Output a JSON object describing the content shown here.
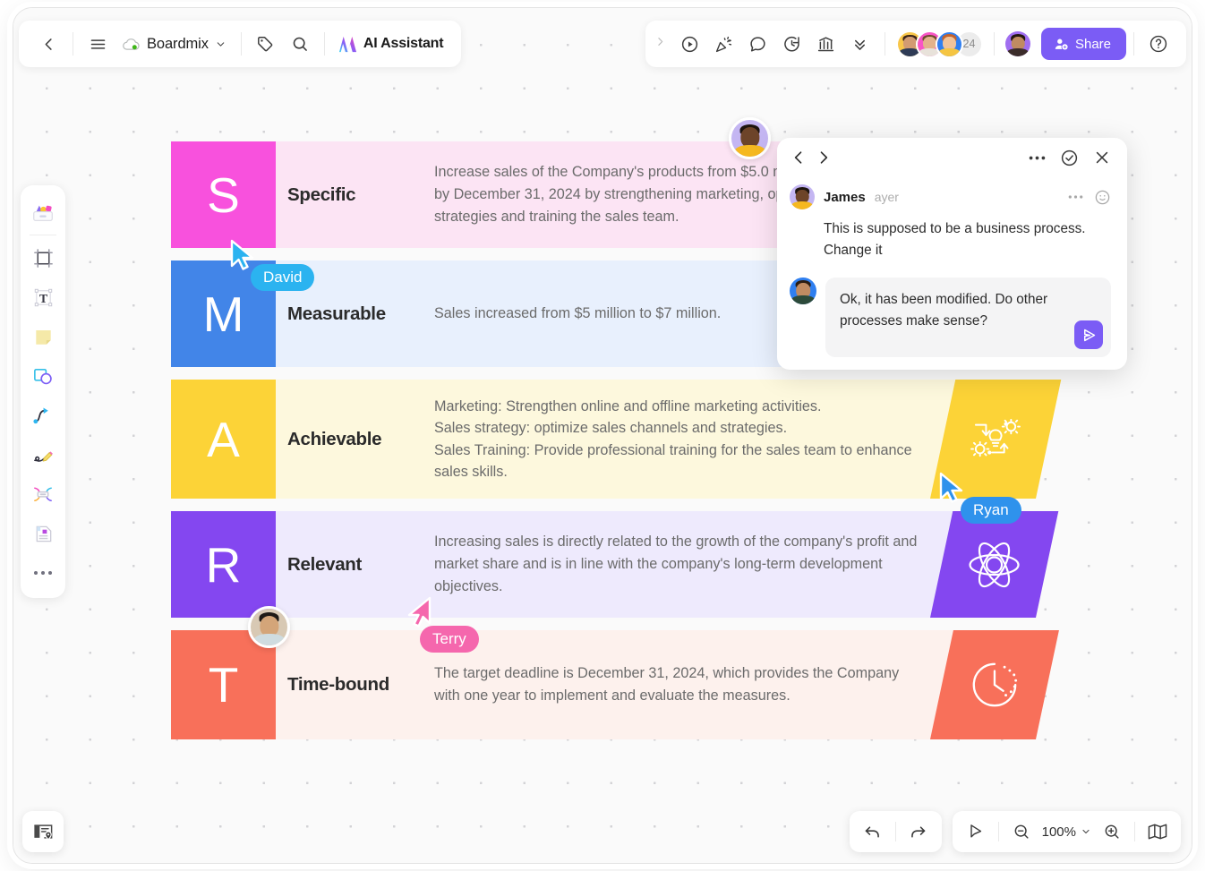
{
  "app": {
    "doc_title": "Boardmix",
    "ai_assistant_label": "AI Assistant"
  },
  "toolbar": {
    "back_icon": "chevron-left-icon",
    "menu_icon": "hamburger-menu-icon",
    "cloud_icon": "cloud-saved-icon",
    "dropdown_icon": "chevron-down-icon",
    "tag_icon": "tag-icon",
    "search_icon": "search-icon",
    "ai_logo_icon": "ai-sparkle-logo-icon"
  },
  "toolbar_right": {
    "expand_icon": "chevron-right-icon",
    "present_icon": "play-present-icon",
    "celebrate_icon": "party-popper-icon",
    "comment_icon": "comment-bubble-icon",
    "timer_icon": "timer-icon",
    "chart_icon": "bar-chart-icon",
    "collapse_icon": "double-chevron-down-icon",
    "collaborator_count": "24",
    "share_label": "Share",
    "share_icon": "add-user-icon",
    "help_icon": "help-circle-icon",
    "share_color": "#7b5cf5"
  },
  "left_rail": {
    "items": [
      {
        "name": "templates-icon",
        "label": "Templates"
      },
      {
        "name": "frame-icon",
        "label": "Frame"
      },
      {
        "name": "text-icon",
        "label": "Text"
      },
      {
        "name": "sticky-note-icon",
        "label": "Sticky note"
      },
      {
        "name": "shapes-icon",
        "label": "Shapes"
      },
      {
        "name": "connector-icon",
        "label": "Connector"
      },
      {
        "name": "pen-icon",
        "label": "Pen"
      },
      {
        "name": "mindmap-icon",
        "label": "Mind map"
      },
      {
        "name": "document-icon",
        "label": "Document"
      },
      {
        "name": "more-icon",
        "label": "More"
      }
    ]
  },
  "smart": {
    "rows": [
      {
        "letter": "S",
        "title": "Specific",
        "text": "Increase sales of the Company's products from $5.0 million to $7.0 million by December 31, 2024 by strengthening marketing, optimizing sales strategies and training the sales team.",
        "accent": "#f851dd",
        "bg": "#fce4f4",
        "shape_icon": null
      },
      {
        "letter": "M",
        "title": "Measurable",
        "text": "Sales increased from $5 million to $7 million.",
        "accent": "#4285e8",
        "bg": "#e8f0fd",
        "shape_icon": null
      },
      {
        "letter": "A",
        "title": "Achievable",
        "text": "Marketing: Strengthen online and offline marketing activities.\nSales strategy: optimize sales channels and strategies.\nSales Training: Provide professional training for the sales team to enhance sales skills.",
        "accent": "#fcd337",
        "bg": "#fdf8dd",
        "shape_icon": "process-gears-icon"
      },
      {
        "letter": "R",
        "title": "Relevant",
        "text": "Increasing sales is directly related to the growth of the company's profit and market share and is in line with the company's long-term development objectives.",
        "accent": "#8447f0",
        "bg": "#eeeafd",
        "shape_icon": "atom-icon"
      },
      {
        "letter": "T",
        "title": "Time-bound",
        "text": "The target deadline is December 31, 2024, which provides the Company with one year to implement and evaluate the measures.",
        "accent": "#f8705a",
        "bg": "#fdf1ed",
        "shape_icon": "clock-icon"
      }
    ]
  },
  "comment_panel": {
    "prev_icon": "chevron-left-icon",
    "next_icon": "chevron-right-icon",
    "more_icon": "more-horizontal-icon",
    "resolve_icon": "check-circle-icon",
    "close_icon": "close-icon",
    "message": {
      "author": "James",
      "time": "ayer",
      "more_icon": "more-horizontal-icon",
      "emoji_icon": "emoji-smiley-icon",
      "text": "This is supposed to be a business process. Change it"
    },
    "reply": {
      "text": "Ok, it has been modified. Do other processes make sense?",
      "send_icon": "send-icon",
      "send_color": "#7b5cf5"
    }
  },
  "cursors": [
    {
      "name": "David",
      "color": "#2bb3f0",
      "pointer_color": "#3aa3e8"
    },
    {
      "name": "Ryan",
      "color": "#2f92ec",
      "pointer_color": "#3a8fe0"
    },
    {
      "name": "Terry",
      "color": "#f567ad",
      "pointer_color": "#f3539f"
    }
  ],
  "bottom": {
    "presentation_icon": "card-location-icon",
    "undo_icon": "undo-icon",
    "redo_icon": "redo-icon",
    "select_icon": "cursor-select-icon",
    "zoom_out_icon": "zoom-out-icon",
    "zoom_level": "100%",
    "zoom_dropdown_icon": "chevron-down-icon",
    "zoom_in_icon": "zoom-in-icon",
    "minimap_icon": "minimap-icon"
  }
}
